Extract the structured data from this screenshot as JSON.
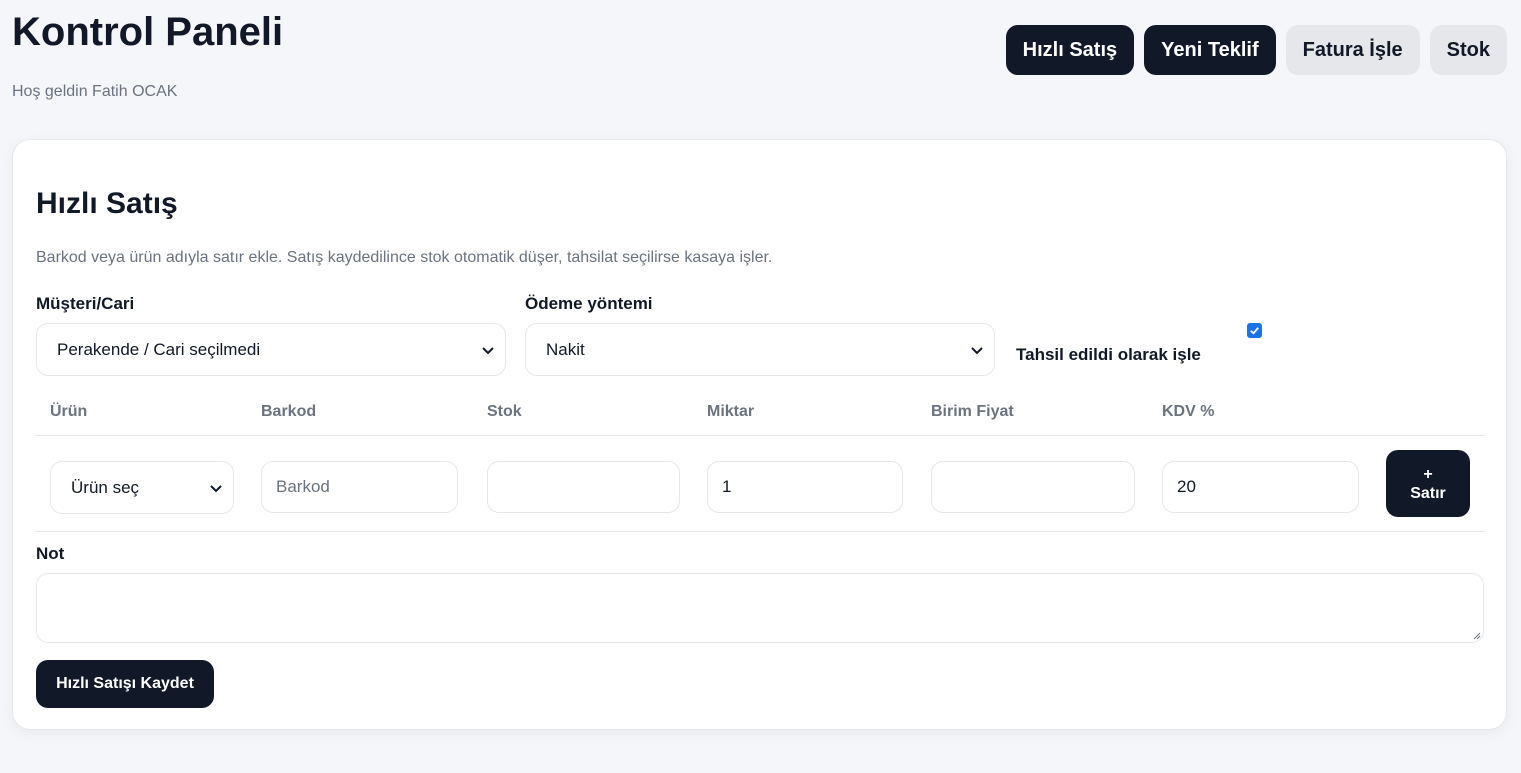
{
  "header": {
    "title": "Kontrol Paneli",
    "subtitle": "Hoş geldin Fatih OCAK",
    "actions": [
      {
        "label": "Hızlı Satış",
        "variant": "dark"
      },
      {
        "label": "Yeni Teklif",
        "variant": "dark"
      },
      {
        "label": "Fatura İşle",
        "variant": "light"
      },
      {
        "label": "Stok",
        "variant": "light"
      }
    ]
  },
  "quick_sale": {
    "title": "Hızlı Satış",
    "description": "Barkod veya ürün adıyla satır ekle. Satış kaydedilince stok otomatik düşer, tahsilat seçilirse kasaya işler.",
    "customer_label": "Müşteri/Cari",
    "customer_value": "Perakende / Cari seçilmedi",
    "payment_label": "Ödeme yöntemi",
    "payment_value": "Nakit",
    "collected_label": "Tahsil edildi olarak işle",
    "collected_checked": true,
    "columns": [
      "Ürün",
      "Barkod",
      "Stok",
      "Miktar",
      "Birim Fiyat",
      "KDV %"
    ],
    "row": {
      "product_value": "Ürün seç",
      "barcode_placeholder": "Barkod",
      "stock_value": "",
      "quantity_value": "1",
      "unit_price_value": "",
      "vat_value": "20"
    },
    "add_row_plus": "+",
    "add_row_label": "Satır",
    "note_label": "Not",
    "note_value": "",
    "save_label": "Hızlı Satışı Kaydet"
  },
  "colors": {
    "primary_dark": "#111827",
    "secondary_button": "#e5e7eb",
    "checkbox_accent": "#1a73e8",
    "muted_text": "#6b7280",
    "page_background": "#f5f6f9"
  }
}
